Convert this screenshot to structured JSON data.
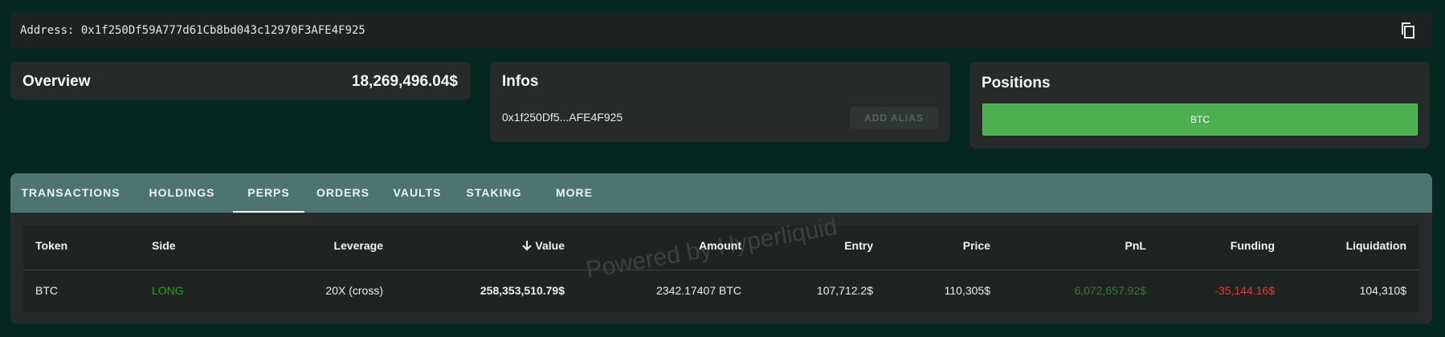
{
  "address_bar": {
    "text": "Address: 0x1f250Df59A777d61Cb8bd043c12970F3AFE4F925",
    "copy_icon": "copy-icon"
  },
  "overview": {
    "title": "Overview",
    "value": "18,269,496.04$"
  },
  "infos": {
    "title": "Infos",
    "short_address": "0x1f250Df5...AFE4F925",
    "alias_button": "ADD ALIAS"
  },
  "positions": {
    "title": "Positions",
    "bar_label": "BTC"
  },
  "tabs": [
    {
      "label": "TRANSACTIONS",
      "active": false
    },
    {
      "label": "HOLDINGS",
      "active": false
    },
    {
      "label": "PERPS",
      "active": true
    },
    {
      "label": "ORDERS",
      "active": false
    },
    {
      "label": "VAULTS",
      "active": false
    },
    {
      "label": "STAKING",
      "active": false
    },
    {
      "label": "MORE",
      "active": false
    }
  ],
  "table": {
    "watermark": "Powered by Hyperliquid",
    "sort_icon": "arrow-down-icon",
    "headers": [
      "Token",
      "Side",
      "Leverage",
      "Value",
      "Amount",
      "Entry",
      "Price",
      "PnL",
      "Funding",
      "Liquidation"
    ],
    "rows": [
      [
        "BTC",
        "LONG",
        "20X (cross)",
        "258,353,510.79$",
        "2342.17407 BTC",
        "107,712.2$",
        "110,305$",
        "6,072,657.92$",
        "-35,144.16$",
        "104,310$"
      ]
    ]
  },
  "colors": {
    "background": "#062620",
    "card": "#262a29",
    "tabbar": "#4e7470",
    "position_bar": "#4caf50",
    "long": "#1fa31f",
    "pnl": "#2e7d32",
    "funding": "#e53935"
  }
}
